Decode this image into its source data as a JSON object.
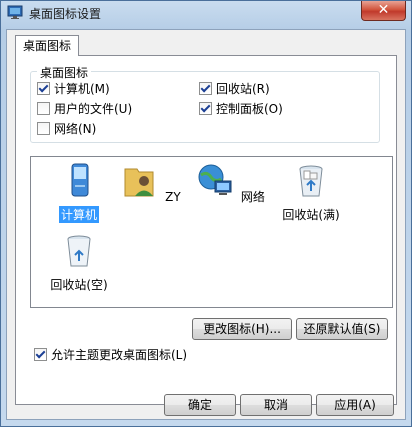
{
  "window": {
    "title": "桌面图标设置",
    "close_glyph": "✕"
  },
  "tab": {
    "label": "桌面图标"
  },
  "group": {
    "title": "桌面图标",
    "checkboxes": [
      {
        "label": "计算机(M)",
        "checked": true
      },
      {
        "label": "回收站(R)",
        "checked": true
      },
      {
        "label": "用户的文件(U)",
        "checked": false
      },
      {
        "label": "控制面板(O)",
        "checked": true
      },
      {
        "label": "网络(N)",
        "checked": false
      }
    ]
  },
  "icons": [
    {
      "label": "计算机",
      "icon": "computer-icon",
      "selected": true
    },
    {
      "label": "ZY",
      "icon": "user-folder-icon",
      "selected": false
    },
    {
      "label": "网络",
      "icon": "network-icon",
      "selected": false
    },
    {
      "label": "回收站(满)",
      "icon": "recycle-bin-full-icon",
      "selected": false
    },
    {
      "label": "回收站(空)",
      "icon": "recycle-bin-empty-icon",
      "selected": false
    }
  ],
  "buttons": {
    "change_icon": "更改图标(H)...",
    "restore_default": "还原默认值(S)",
    "ok": "确定",
    "cancel": "取消",
    "apply": "应用(A)"
  },
  "allow_themes": {
    "label": "允许主题更改桌面图标(L)",
    "checked": true
  },
  "colors": {
    "selection": "#3399ff",
    "title_gradient_top": "#c9dcef"
  }
}
